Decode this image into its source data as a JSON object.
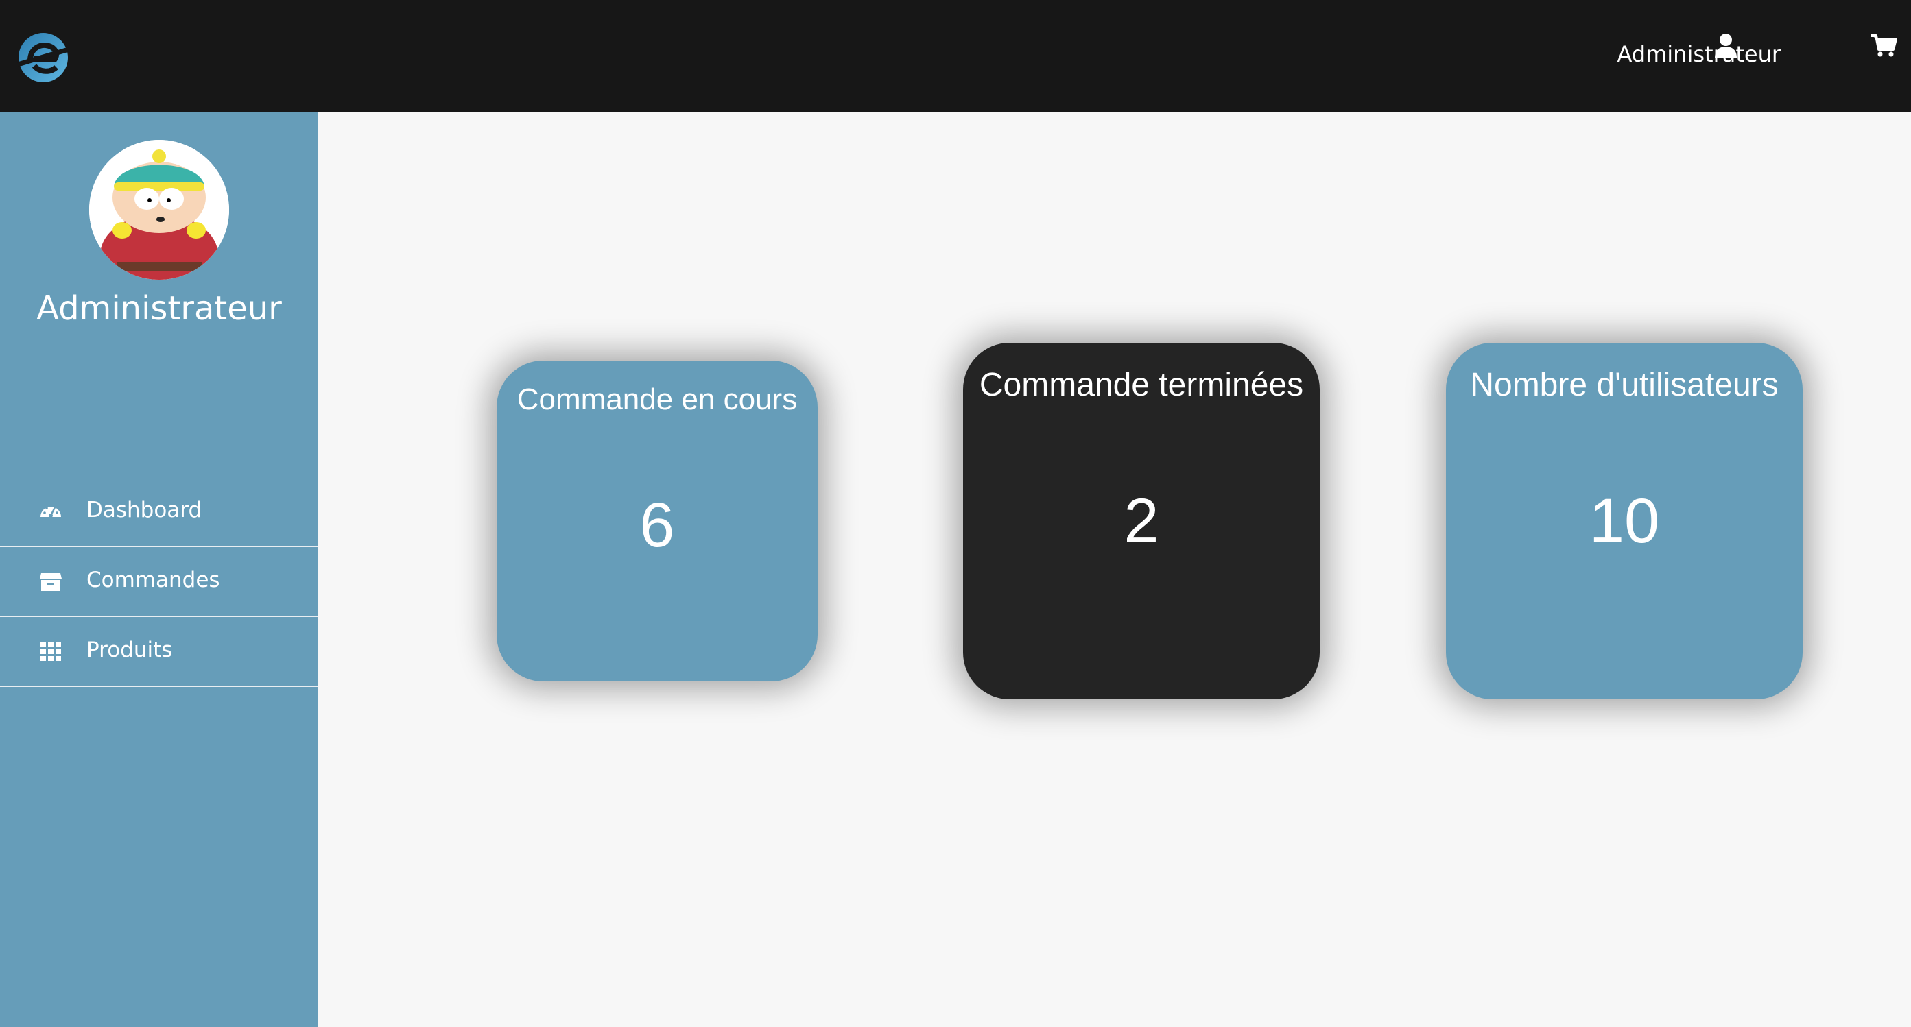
{
  "header": {
    "logo_icon": "e-logo-icon",
    "user_label": "Administrateur",
    "icons": [
      "user-icon",
      "cart-icon"
    ]
  },
  "sidebar": {
    "avatar": "cartman-avatar",
    "name": "Administrateur",
    "items": [
      {
        "label": "Dashboard",
        "icon": "dashboard-gauge-icon"
      },
      {
        "label": "Commandes",
        "icon": "box-icon"
      },
      {
        "label": "Produits",
        "icon": "grid-icon"
      }
    ]
  },
  "cards": [
    {
      "title": "Commande en cours",
      "value": "6",
      "color": "#669db9"
    },
    {
      "title": "Commande terminées",
      "value": "2",
      "color": "#242424"
    },
    {
      "title": "Nombre d'utilisateurs",
      "value": "10",
      "color": "#669db9"
    }
  ],
  "colors": {
    "topbar": "#171717",
    "sidebar": "#669db9",
    "background": "#f7f7f7",
    "accent": "#3a8fc0"
  }
}
